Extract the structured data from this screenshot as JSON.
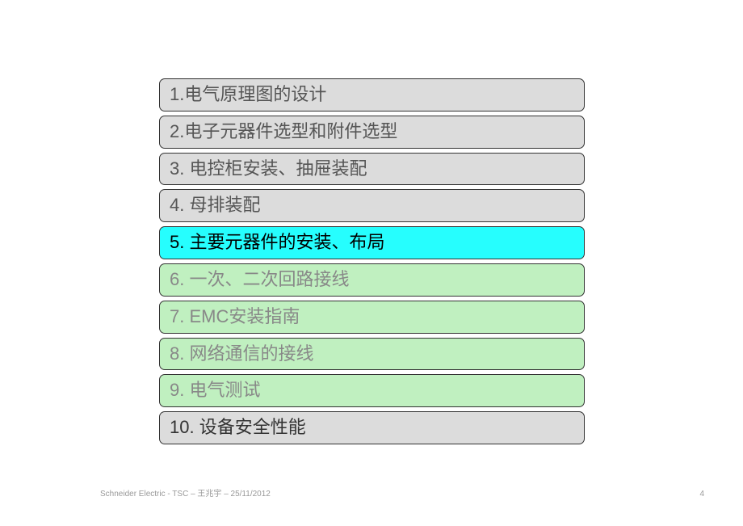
{
  "items": [
    {
      "label": "1.电气原理图的设计",
      "style": "item-gray"
    },
    {
      "label": "2.电子元器件选型和附件选型",
      "style": "item-gray"
    },
    {
      "label": "3. 电控柜安装、抽屉装配",
      "style": "item-gray"
    },
    {
      "label": "4. 母排装配",
      "style": "item-gray"
    },
    {
      "label": "5. 主要元器件的安装、布局",
      "style": "item-cyan"
    },
    {
      "label": "6. 一次、二次回路接线",
      "style": "item-green"
    },
    {
      "label": "7. EMC安装指南",
      "style": "item-green"
    },
    {
      "label": "8. 网络通信的接线",
      "style": "item-green"
    },
    {
      "label": "9. 电气测试",
      "style": "item-green"
    },
    {
      "label": "10. 设备安全性能",
      "style": "item-gray-last"
    }
  ],
  "footer": {
    "text": "Schneider Electric - TSC – 王兆宇 – 25/11/2012"
  },
  "page_number": "4"
}
